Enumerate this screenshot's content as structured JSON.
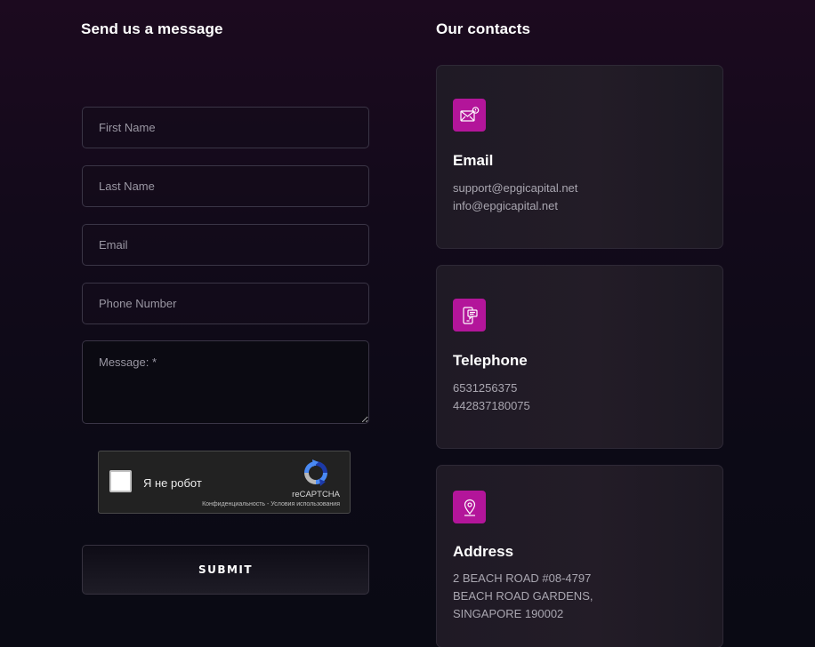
{
  "form": {
    "heading": "Send us a message",
    "first_name_placeholder": "First Name",
    "last_name_placeholder": "Last Name",
    "email_placeholder": "Email",
    "phone_placeholder": "Phone Number",
    "message_placeholder": "Message: *",
    "submit_label": "SUBMIT"
  },
  "captcha": {
    "label": "Я не робот",
    "brand": "reCAPTCHA",
    "links": "Конфиденциальность - Условия использования",
    "icon": "recaptcha-logo-icon"
  },
  "contacts": {
    "heading": "Our contacts",
    "accent_color": "#b3159a",
    "cards": [
      {
        "icon": "mail-icon",
        "title": "Email",
        "lines": [
          "support@epgicapital.net",
          "info@epgicapital.net"
        ]
      },
      {
        "icon": "mobile-chat-icon",
        "title": "Telephone",
        "lines": [
          "6531256375",
          "442837180075"
        ]
      },
      {
        "icon": "location-pin-icon",
        "title": "Address",
        "lines": [
          "2 BEACH ROAD #08-4797",
          "BEACH ROAD GARDENS,",
          "SINGAPORE 190002"
        ]
      }
    ]
  }
}
